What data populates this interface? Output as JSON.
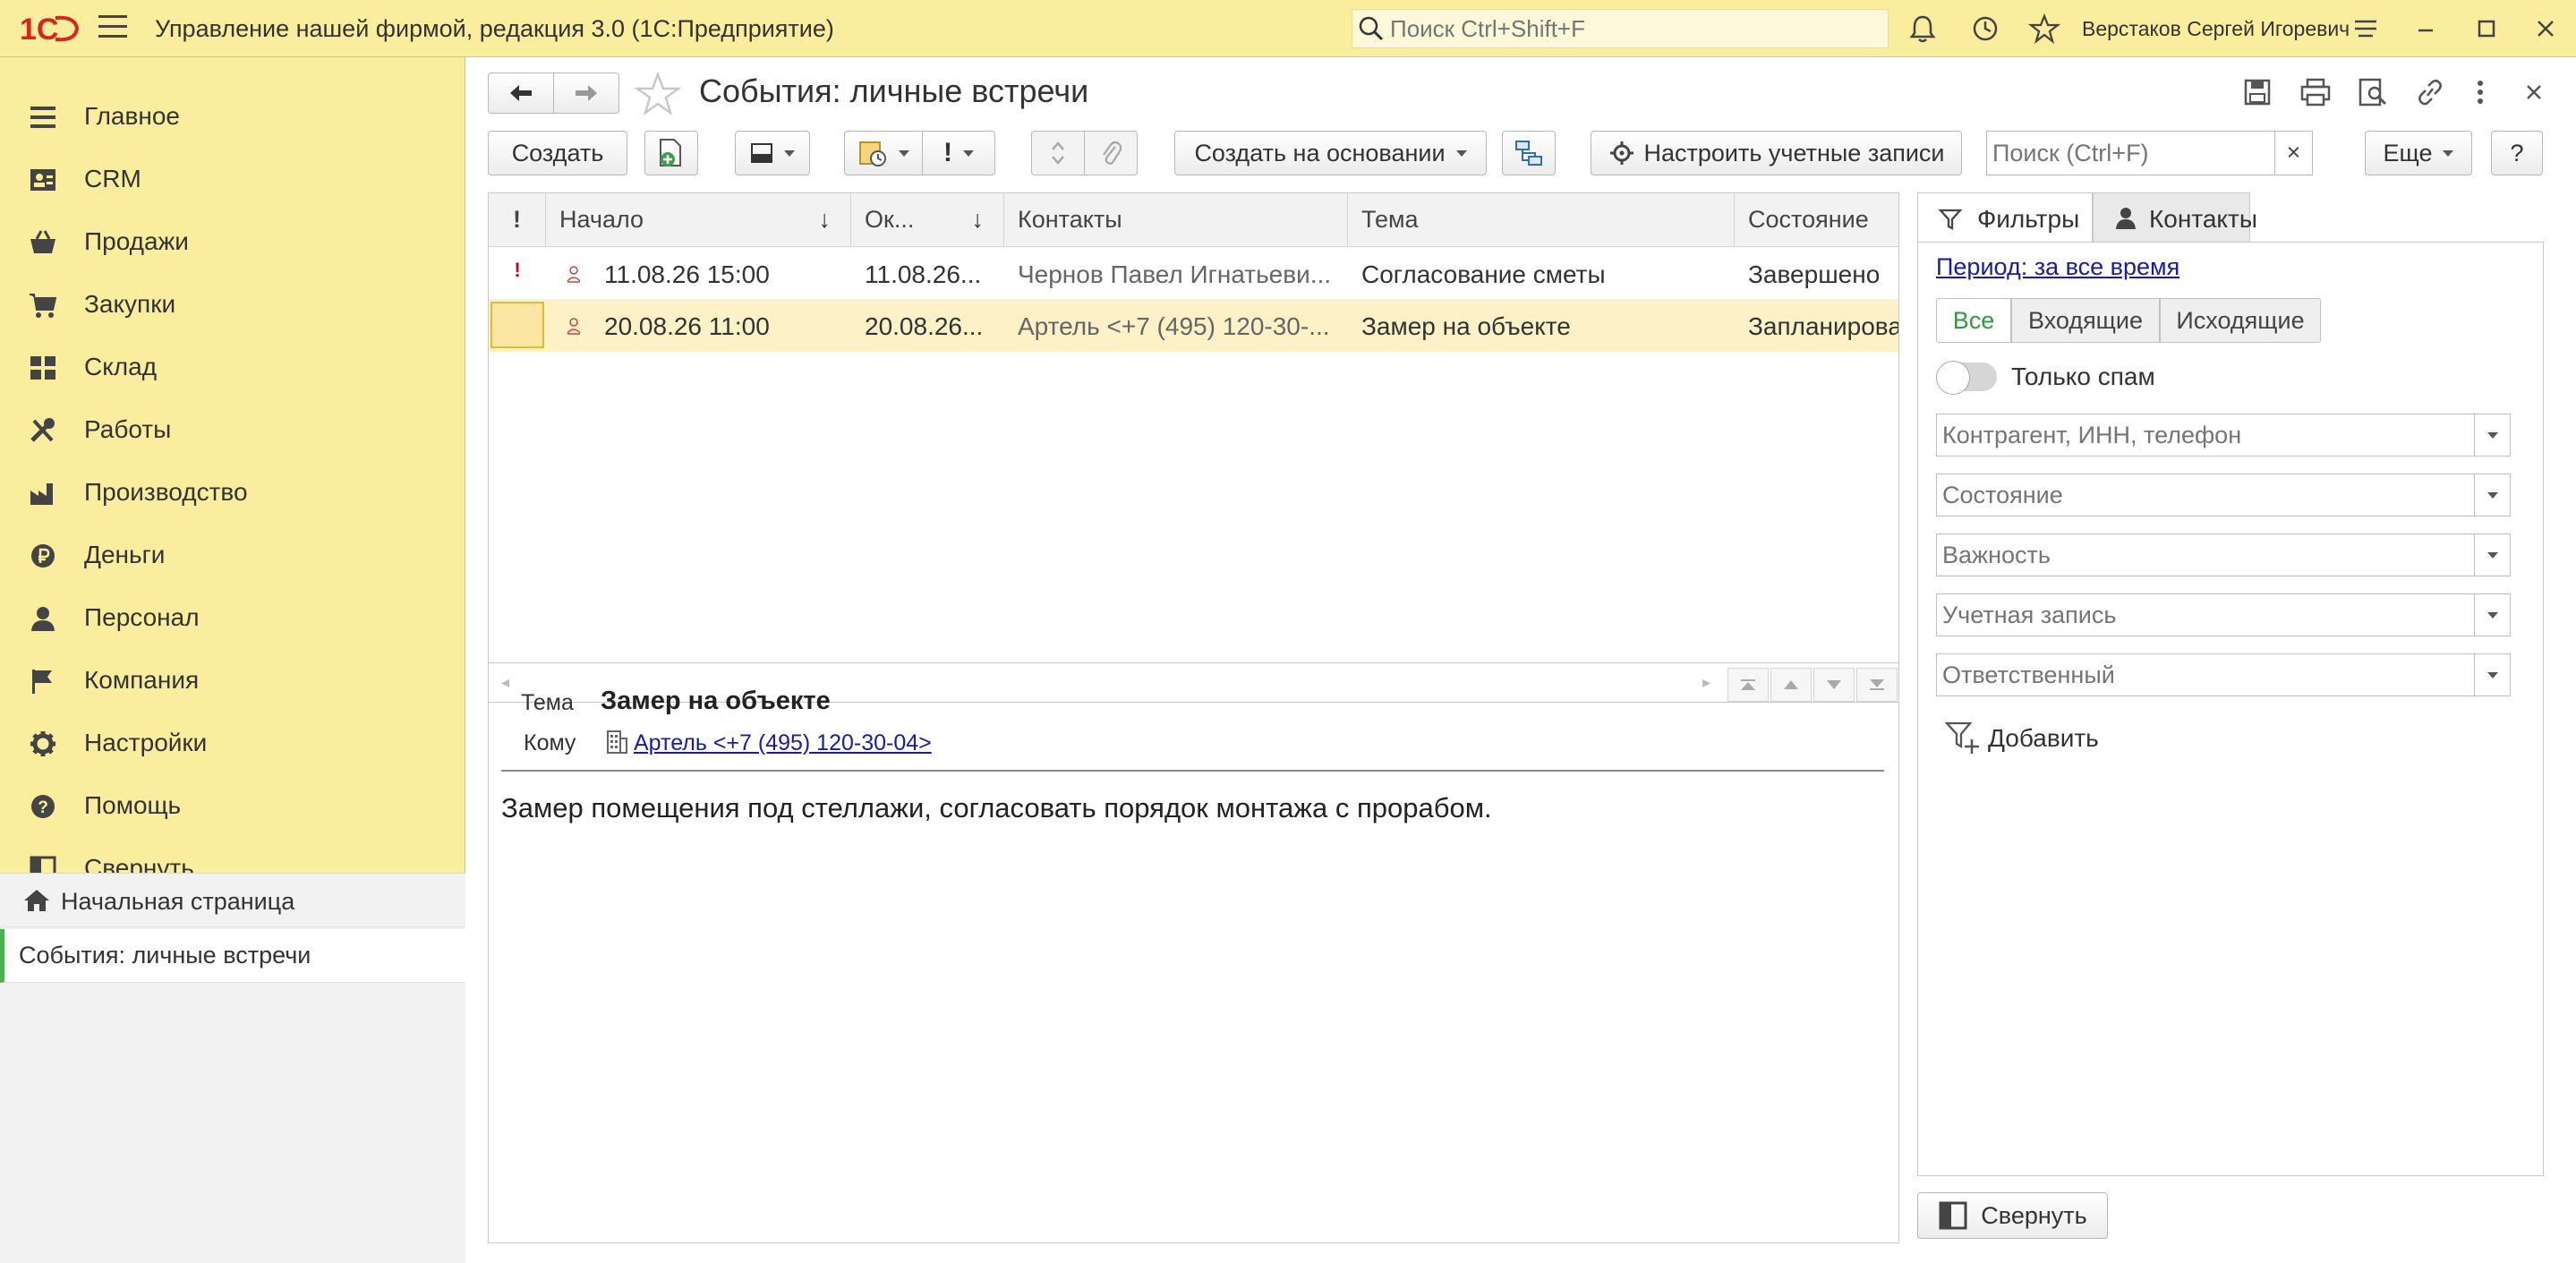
{
  "titlebar": {
    "logo_text": "1С",
    "app_title": "Управление нашей фирмой, редакция 3.0  (1С:Предприятие)",
    "search_placeholder": "Поиск Ctrl+Shift+F",
    "user_name": "Верстаков Сергей Игоревич",
    "icons": [
      "notifications-bell-icon",
      "history-icon",
      "favorites-star-icon",
      "settings-sliders-icon",
      "minimize-icon",
      "maximize-icon",
      "close-icon"
    ]
  },
  "sidebar": {
    "items": [
      {
        "label": "Главное",
        "icon": "menu-lines-icon"
      },
      {
        "label": "CRM",
        "icon": "contact-card-icon"
      },
      {
        "label": "Продажи",
        "icon": "basket-icon"
      },
      {
        "label": "Закупки",
        "icon": "cart-icon"
      },
      {
        "label": "Склад",
        "icon": "warehouse-grid-icon"
      },
      {
        "label": "Работы",
        "icon": "tools-icon"
      },
      {
        "label": "Производство",
        "icon": "factory-icon"
      },
      {
        "label": "Деньги",
        "icon": "ruble-coin-icon"
      },
      {
        "label": "Персонал",
        "icon": "person-icon"
      },
      {
        "label": "Компания",
        "icon": "flag-icon"
      },
      {
        "label": "Настройки",
        "icon": "gear-icon"
      },
      {
        "label": "Помощь",
        "icon": "help-icon"
      },
      {
        "label": "Свернуть",
        "icon": "collapse-panel-icon"
      }
    ],
    "open_windows": {
      "home": "Начальная страница",
      "current": "События: личные встречи"
    }
  },
  "form": {
    "title": "События: личные встречи",
    "toolbar": {
      "create": "Создать",
      "create_based_on": "Создать на основании",
      "setup_accounts": "Настроить учетные записи",
      "search_placeholder": "Поиск (Ctrl+F)",
      "search_clear": "×",
      "more": "Еще",
      "help": "?",
      "importance": "!"
    },
    "list": {
      "headers": {
        "importance": "!",
        "start": "Начало",
        "end": "Ок...",
        "contacts": "Контакты",
        "topic": "Тема",
        "state": "Состояние"
      },
      "rows": [
        {
          "importance": "!",
          "start": "11.08.26 15:00",
          "end": "11.08.26...",
          "contacts": "Чернов Павел Игнатьеви...",
          "topic": "Согласование сметы",
          "state": "Завершено"
        },
        {
          "importance": "",
          "start": "20.08.26 11:00",
          "end": "20.08.26...",
          "contacts": "Артель <+7 (495) 120-30-...",
          "topic": "Замер на объекте",
          "state": "Запланировано"
        }
      ]
    },
    "preview": {
      "topic_label": "Тема",
      "topic": "Замер на объекте",
      "to_label": "Кому",
      "to": "Артель <+7 (495) 120-30-04>",
      "body": "Замер помещения под стеллажи, согласовать порядок монтажа с прорабом."
    },
    "right_panel": {
      "tab_filters": "Фильтры",
      "tab_contacts": "Контакты",
      "period": "Период: за все время",
      "segments": [
        "Все",
        "Входящие",
        "Исходящие"
      ],
      "spam_label": "Только спам",
      "fields": [
        "Контрагент, ИНН, телефон",
        "Состояние",
        "Важность",
        "Учетная запись",
        "Ответственный"
      ],
      "add_filter": "Добавить",
      "collapse": "Свернуть"
    }
  },
  "colors": {
    "section_panel": "#fbed9e",
    "selected_row": "#fcf1c7",
    "link": "#1a1aa6",
    "accent_green": "#2e9b3e",
    "importance_red": "#d0021b"
  }
}
